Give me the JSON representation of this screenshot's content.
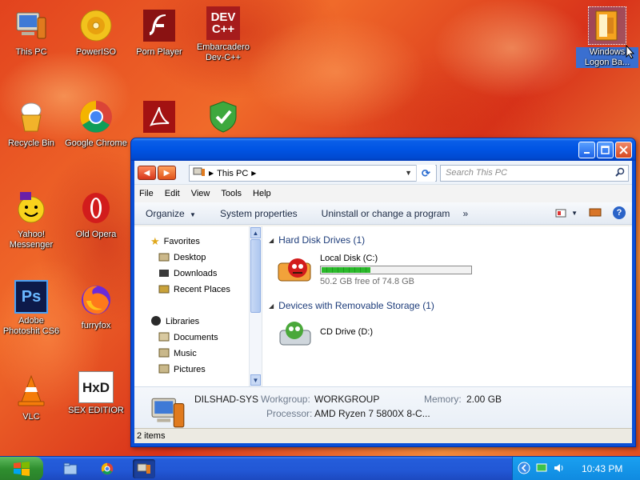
{
  "desktop": {
    "icons": [
      {
        "label": "This PC"
      },
      {
        "label": "PowerISO"
      },
      {
        "label": "Porn Player"
      },
      {
        "label": "Embarcadero Dev-C++"
      },
      {
        "label": "Windows Logon Ba..."
      },
      {
        "label": "Recycle Bin"
      },
      {
        "label": "Google Chrome"
      },
      {
        "label": "Yahoo! Messenger"
      },
      {
        "label": "Old Opera"
      },
      {
        "label": "Adobe Photoshit CS6"
      },
      {
        "label": "furryfox"
      },
      {
        "label": "VLC"
      },
      {
        "label": "SEX EDITIOR"
      }
    ],
    "devcpp_logo_top": "DEV",
    "devcpp_logo_bottom": "C++",
    "ps_logo": "Ps",
    "hxd_logo": "HxD"
  },
  "window": {
    "address": {
      "location": "This PC"
    },
    "search_placeholder": "Search This PC",
    "menu": [
      "File",
      "Edit",
      "View",
      "Tools",
      "Help"
    ],
    "commands": [
      "Organize",
      "System properties",
      "Uninstall or change a program"
    ],
    "more_symbol": "»",
    "nav": {
      "favorites": "Favorites",
      "fav_items": [
        "Desktop",
        "Downloads",
        "Recent Places"
      ],
      "libraries": "Libraries",
      "lib_items": [
        "Documents",
        "Music",
        "Pictures"
      ]
    },
    "groups": {
      "hdd": "Hard Disk Drives (1)",
      "removable": "Devices with Removable Storage (1)"
    },
    "drives": {
      "c": {
        "name": "Local Disk (C:)",
        "free_text": "50.2 GB free of 74.8 GB",
        "used_fraction": 0.33
      },
      "d": {
        "name": "CD Drive (D:)"
      }
    },
    "details": {
      "computer_name": "DILSHAD-SYS",
      "workgroup_label": "Workgroup:",
      "workgroup": "WORKGROUP",
      "memory_label": "Memory:",
      "memory": "2.00 GB",
      "processor_label": "Processor:",
      "processor": "AMD Ryzen 7 5800X 8-C..."
    },
    "status": "2 items"
  },
  "taskbar": {
    "clock": "10:43 PM"
  }
}
